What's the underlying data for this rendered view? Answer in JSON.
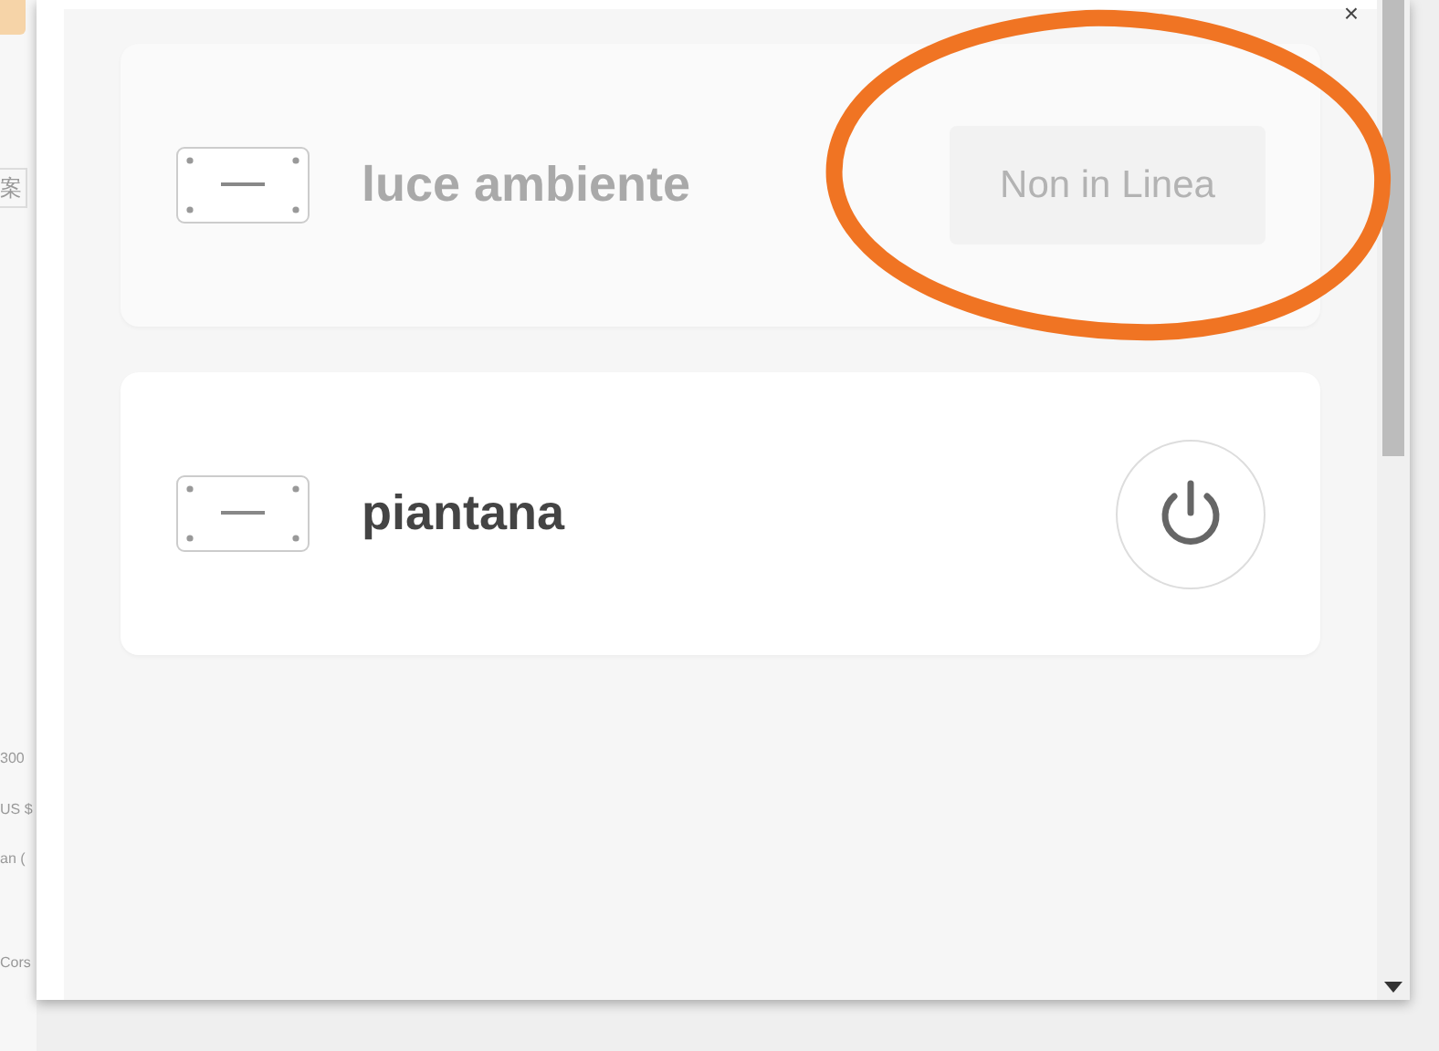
{
  "background_page": {
    "fragments": [
      {
        "text": "案",
        "kind": "boxed"
      },
      {
        "text": "300",
        "kind": "plain"
      },
      {
        "text": "US $",
        "kind": "plain"
      },
      {
        "text": "an (",
        "kind": "plain"
      },
      {
        "text": "Cors",
        "kind": "plain"
      }
    ]
  },
  "dialog": {
    "close": "×",
    "devices": [
      {
        "name": "luce ambiente",
        "online": false,
        "status_label": "Non in Linea"
      },
      {
        "name": "piantana",
        "online": true
      }
    ]
  },
  "annotation": {
    "kind": "ellipse",
    "color": "#f07423"
  }
}
